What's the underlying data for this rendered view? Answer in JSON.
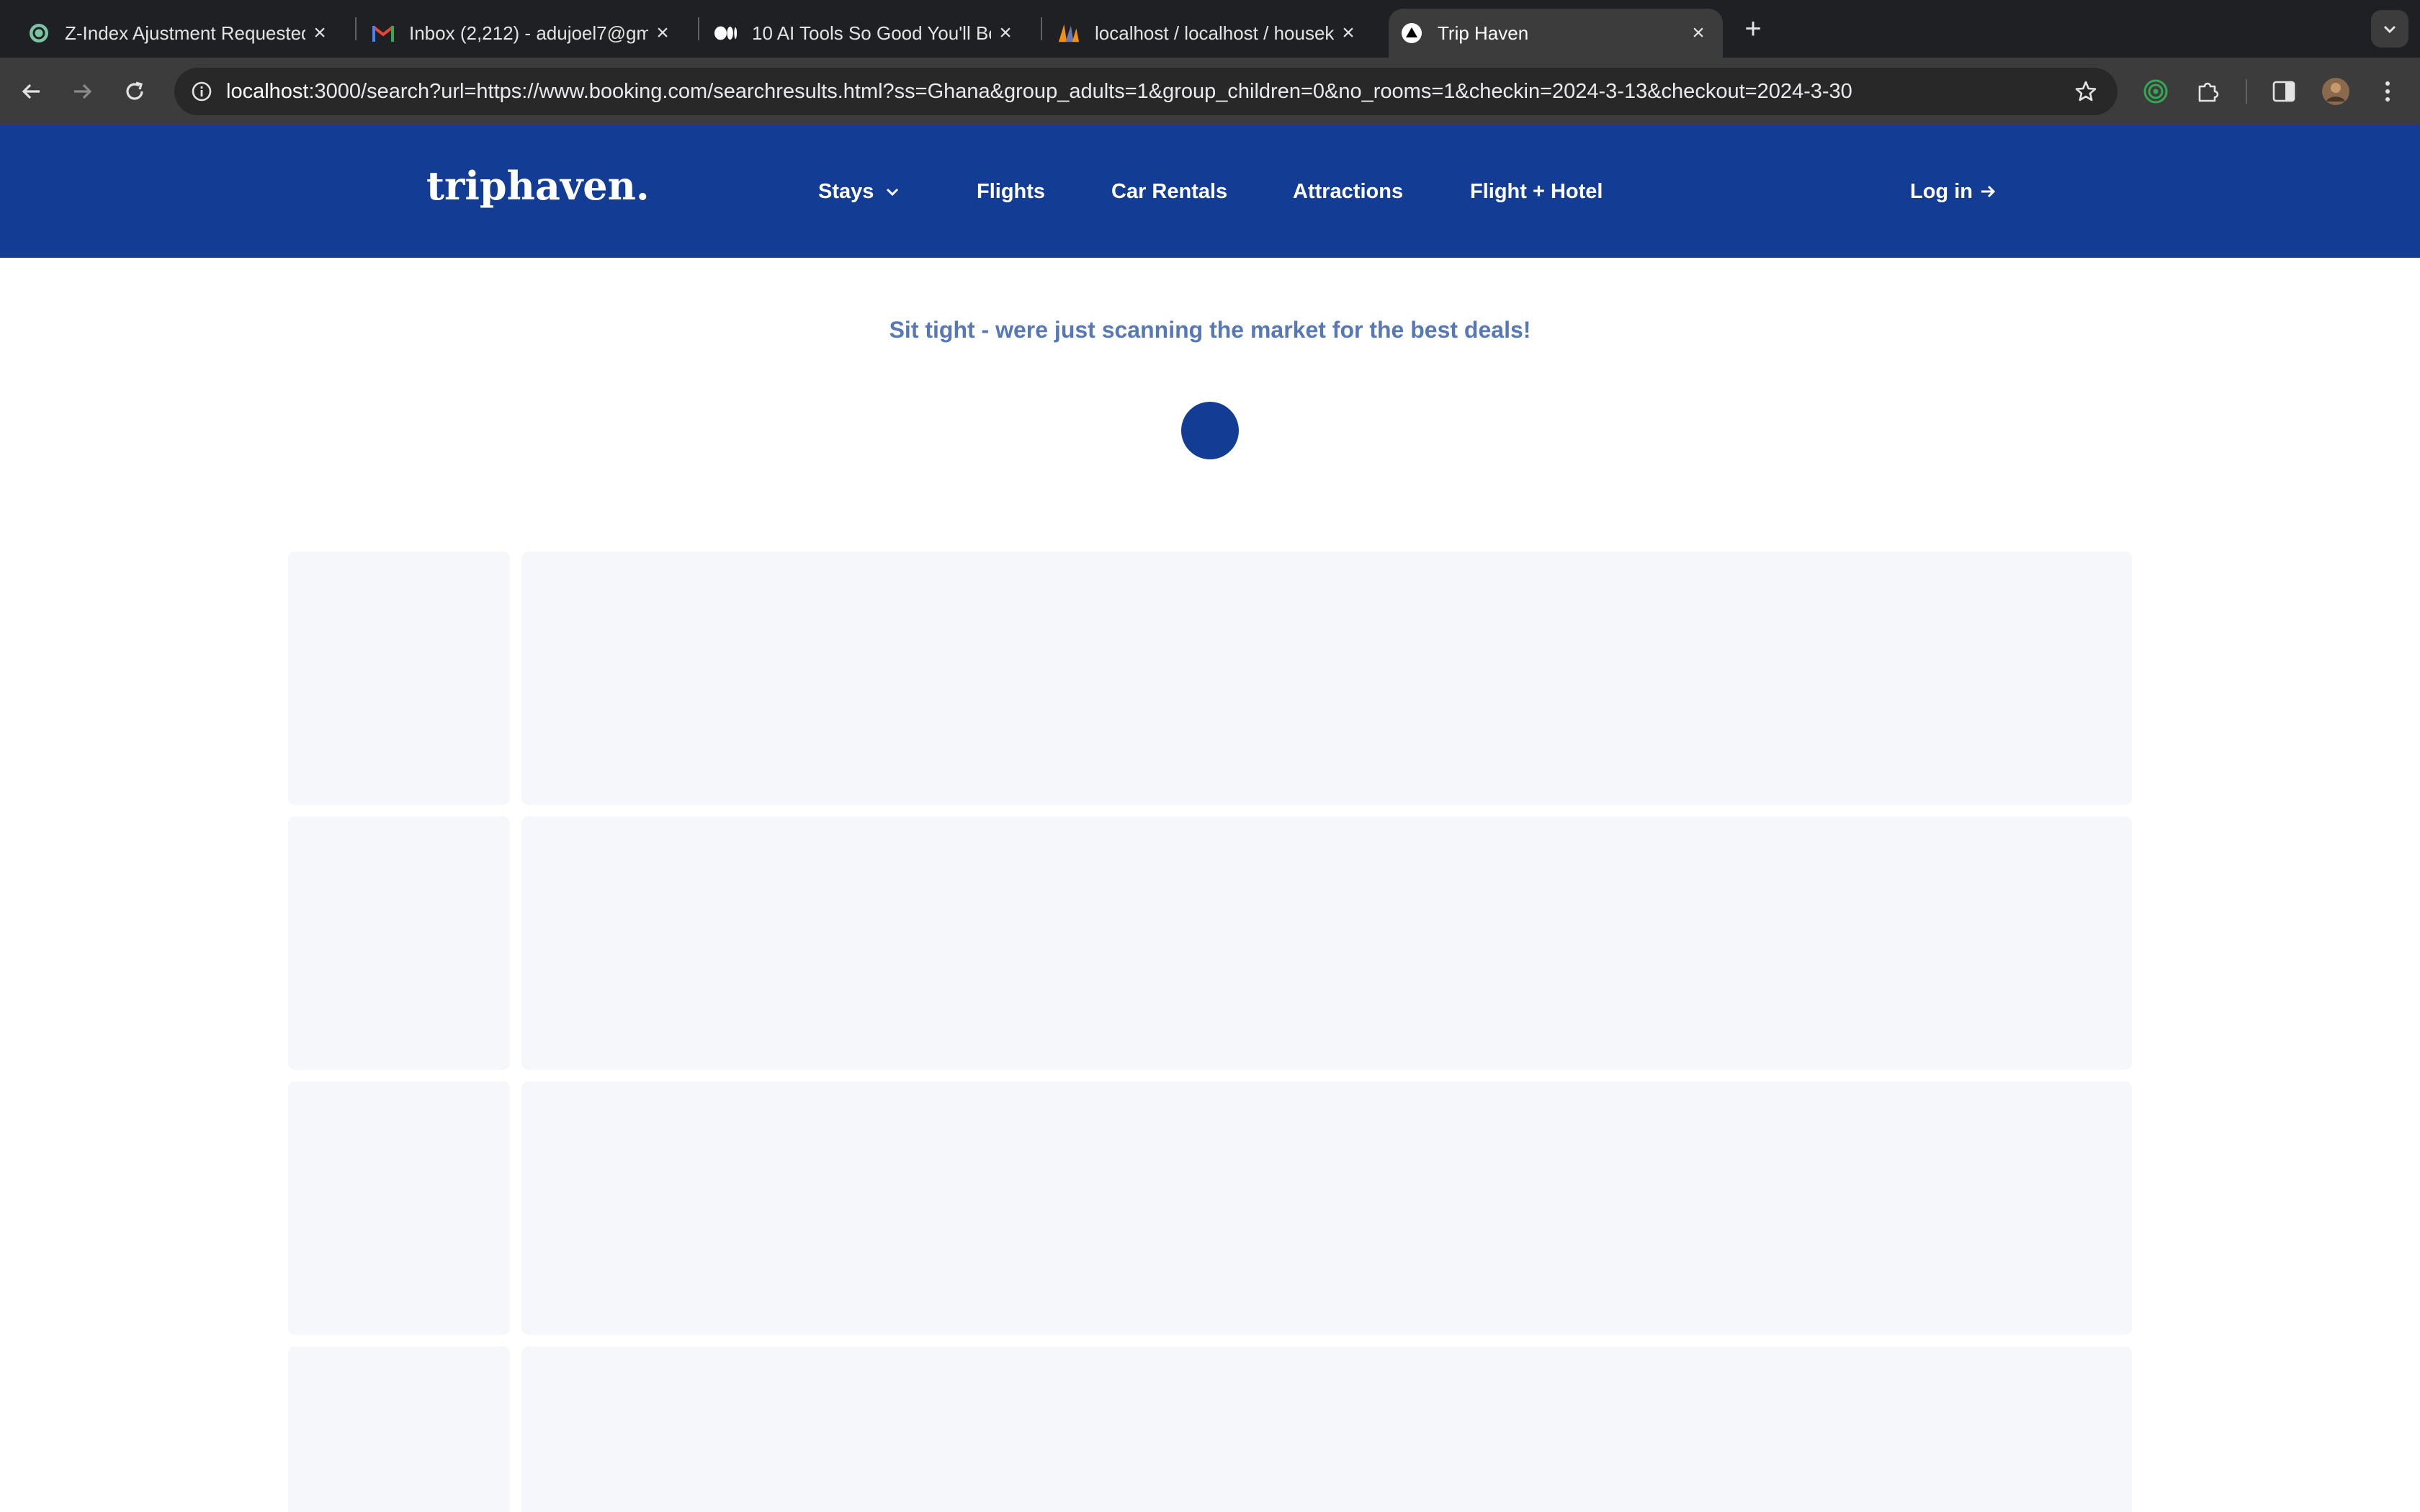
{
  "browser": {
    "tabs": [
      {
        "title": "Z-Index Ajustment Requested",
        "icon": "chatgpt-icon"
      },
      {
        "title": "Inbox (2,212) - adujoel7@gmail.com",
        "icon": "gmail-icon"
      },
      {
        "title": "10 AI Tools So Good You'll Be",
        "icon": "medium-icon"
      },
      {
        "title": "localhost / localhost / housek",
        "icon": "phpmyadmin-icon"
      },
      {
        "title": "Trip Haven",
        "icon": "triangle-icon"
      }
    ],
    "url_host": "localhost",
    "url_rest": ":3000/search?url=https://www.booking.com/searchresults.html?ss=Ghana&group_adults=1&group_children=0&no_rooms=1&checkin=2024-3-13&checkout=2024-3-30"
  },
  "header": {
    "logo": "triphaven.",
    "nav": {
      "stays": "Stays",
      "flights": "Flights",
      "car_rentals": "Car Rentals",
      "attractions": "Attractions",
      "flight_hotel": "Flight + Hotel"
    },
    "login": "Log in"
  },
  "main": {
    "loading_message": "Sit tight - were just scanning the market for the best deals!"
  },
  "colors": {
    "brand": "#133d95",
    "message": "#5678b6",
    "skeleton": "#f5f7fb"
  }
}
